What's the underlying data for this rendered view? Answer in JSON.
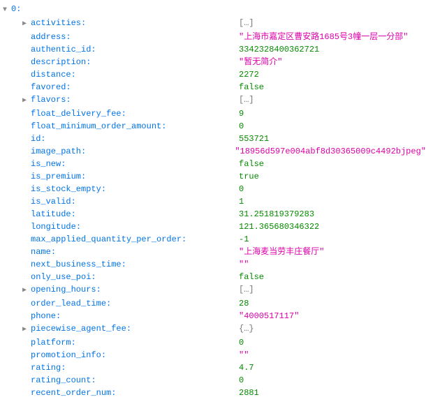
{
  "root": {
    "index": "0",
    "colon": ":"
  },
  "collapsed_array": "[…]",
  "collapsed_object": "{…}",
  "quote": "\"",
  "props": [
    {
      "key": "activities",
      "type": "coll_arr",
      "value": "",
      "expandable": true
    },
    {
      "key": "address",
      "type": "str",
      "value": "上海市嘉定区曹安路1685号3幢一层一分部"
    },
    {
      "key": "authentic_id",
      "type": "num",
      "value": "3342328400362721"
    },
    {
      "key": "description",
      "type": "str",
      "value": "暂无简介"
    },
    {
      "key": "distance",
      "type": "num",
      "value": "2272"
    },
    {
      "key": "favored",
      "type": "bool",
      "value": "false"
    },
    {
      "key": "flavors",
      "type": "coll_arr",
      "value": "",
      "expandable": true
    },
    {
      "key": "float_delivery_fee",
      "type": "num",
      "value": "9"
    },
    {
      "key": "float_minimum_order_amount",
      "type": "num",
      "value": "0"
    },
    {
      "key": "id",
      "type": "num",
      "value": "553721"
    },
    {
      "key": "image_path",
      "type": "str",
      "value": "18956d597e004abf8d30365009c4492bjpeg"
    },
    {
      "key": "is_new",
      "type": "bool",
      "value": "false"
    },
    {
      "key": "is_premium",
      "type": "bool",
      "value": "true"
    },
    {
      "key": "is_stock_empty",
      "type": "num",
      "value": "0"
    },
    {
      "key": "is_valid",
      "type": "num",
      "value": "1"
    },
    {
      "key": "latitude",
      "type": "num",
      "value": "31.251819379283"
    },
    {
      "key": "longitude",
      "type": "num",
      "value": "121.365680346322"
    },
    {
      "key": "max_applied_quantity_per_order",
      "type": "num",
      "value": "-1"
    },
    {
      "key": "name",
      "type": "str",
      "value": "上海麦当劳丰庄餐厅"
    },
    {
      "key": "next_business_time",
      "type": "str",
      "value": ""
    },
    {
      "key": "only_use_poi",
      "type": "bool",
      "value": "false"
    },
    {
      "key": "opening_hours",
      "type": "coll_arr",
      "value": "",
      "expandable": true
    },
    {
      "key": "order_lead_time",
      "type": "num",
      "value": "28"
    },
    {
      "key": "phone",
      "type": "str",
      "value": "4000517117"
    },
    {
      "key": "piecewise_agent_fee",
      "type": "coll_obj",
      "value": "",
      "expandable": true
    },
    {
      "key": "platform",
      "type": "num",
      "value": "0"
    },
    {
      "key": "promotion_info",
      "type": "str",
      "value": ""
    },
    {
      "key": "rating",
      "type": "num",
      "value": "4.7"
    },
    {
      "key": "rating_count",
      "type": "num",
      "value": "0"
    },
    {
      "key": "recent_order_num",
      "type": "num",
      "value": "2881"
    }
  ]
}
